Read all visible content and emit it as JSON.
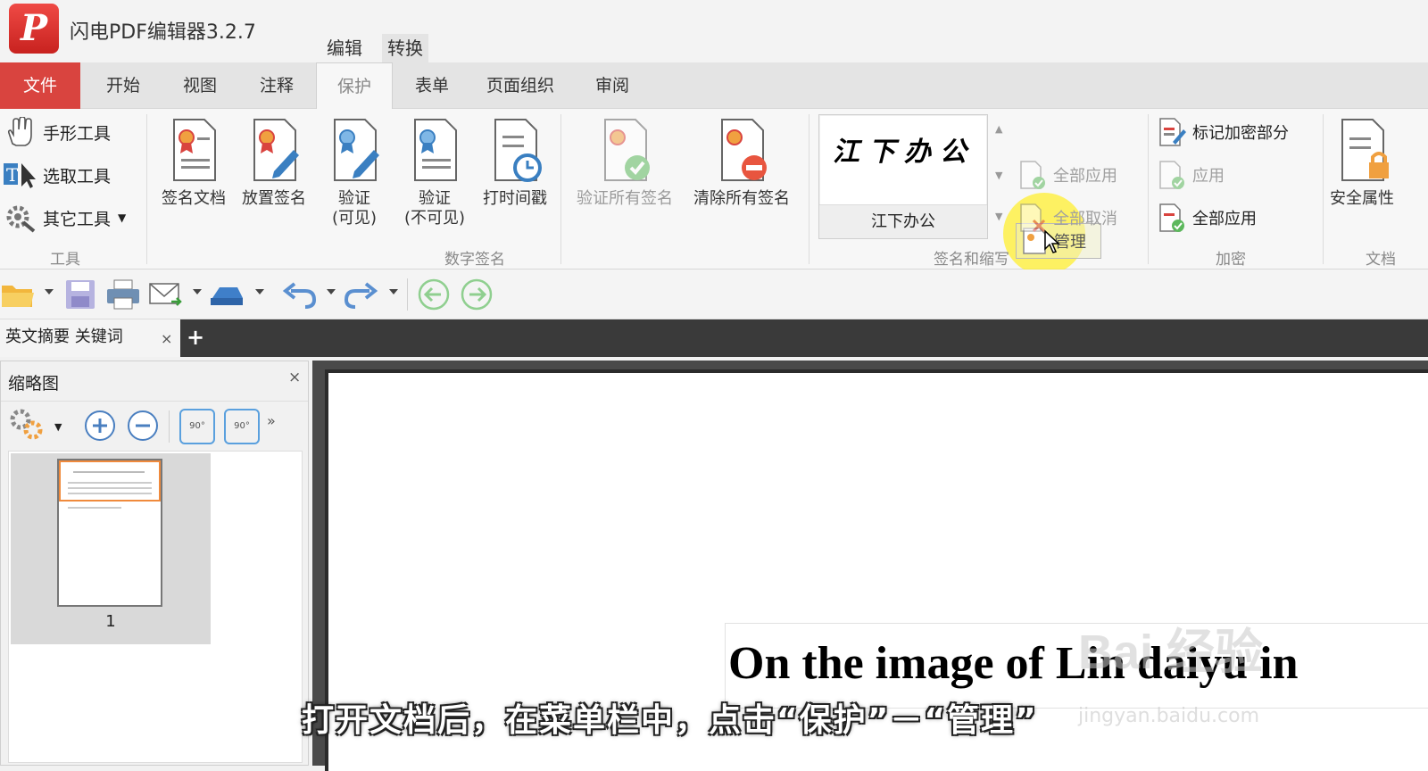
{
  "window": {
    "title": "闪电PDF编辑器3.2.7",
    "logo_letter": "P"
  },
  "context_tabs": [
    "编辑",
    "转换"
  ],
  "menu": {
    "file": "文件",
    "tabs": [
      "开始",
      "视图",
      "注释",
      "保护",
      "表单",
      "页面组织",
      "审阅"
    ],
    "active": "保护"
  },
  "ribbon": {
    "tools": {
      "items": [
        "手形工具",
        "选取工具",
        "其它工具"
      ],
      "group_label": "工具"
    },
    "digital_signature": {
      "items": [
        {
          "label": "签名文档"
        },
        {
          "label": "放置签名"
        },
        {
          "label": "验证",
          "label2": "(可见)"
        },
        {
          "label": "验证",
          "label2": "(不可见)"
        },
        {
          "label": "打时间戳"
        },
        {
          "label": "验证所有签名"
        },
        {
          "label": "清除所有签名"
        }
      ],
      "group_label": "数字签名"
    },
    "signature_initials": {
      "preview_text": "江下办公",
      "signature_name": "江下办公",
      "manage": "管理",
      "apply_all": "全部应用",
      "cancel_all": "全部取消",
      "group_label": "签名和缩写"
    },
    "encrypt": {
      "mark": "标记加密部分",
      "apply": "应用",
      "apply_all": "全部应用",
      "group_label": "加密"
    },
    "doc": {
      "security_props": "安全属性",
      "group_label": "文档"
    }
  },
  "document_tab": {
    "name": "英文摘要 关键词",
    "close": "×",
    "add": "+"
  },
  "thumbnail_panel": {
    "title": "缩略图",
    "close": "×",
    "page_number": "1",
    "rotate_label": "90°"
  },
  "page": {
    "heading": "On the image of Lin daiyu in",
    "watermark": "Bai 经验",
    "watermark_url": "jingyan.baidu.com"
  },
  "subtitle": "打开文档后，在菜单栏中，点击“保护”－“管理”",
  "colors": {
    "accent_red": "#d9443f",
    "highlight": "#ffee28",
    "toolbar_bg": "#f7f7f7"
  }
}
